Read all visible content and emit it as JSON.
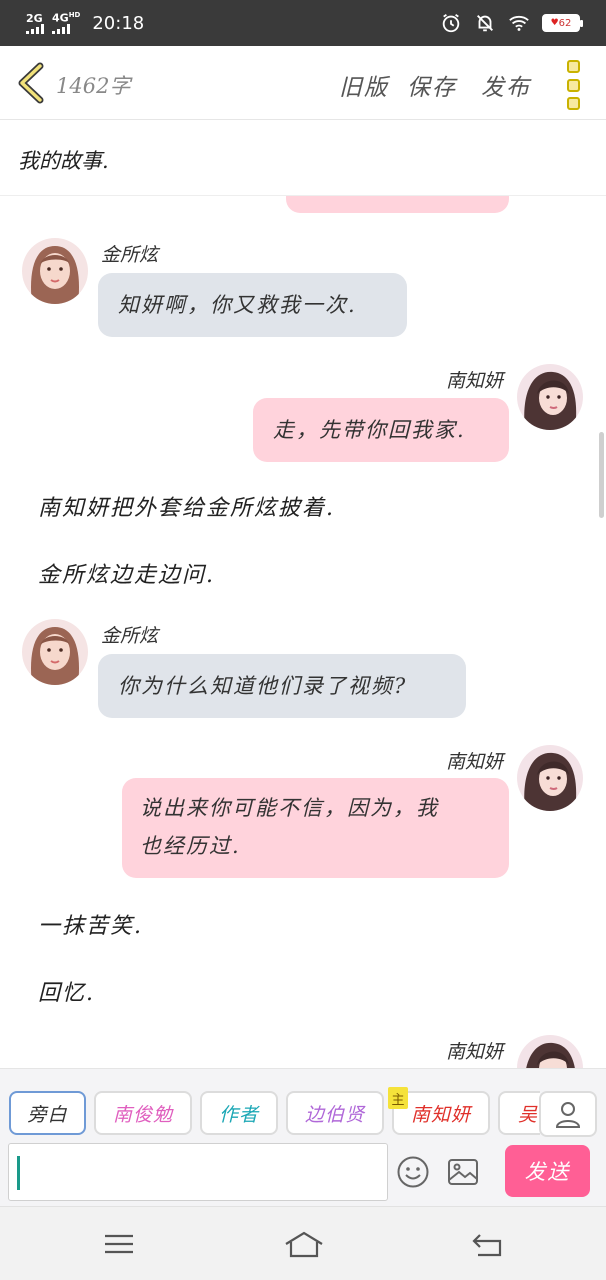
{
  "status_bar": {
    "network_1": "2G",
    "network_2": "4G",
    "network_2_suffix": "HD",
    "time": "20:18",
    "battery_label": "62"
  },
  "header": {
    "word_count": "1462字",
    "old_version": "旧版",
    "save": "保存",
    "publish": "发布"
  },
  "story": {
    "title": "我的故事."
  },
  "chat": {
    "messages": [
      {
        "speaker": "金所炫",
        "text": "知妍啊，你又救我一次."
      },
      {
        "speaker": "南知妍",
        "text": "走，先带你回我家."
      },
      {
        "narration": "南知妍把外套给金所炫披着."
      },
      {
        "narration": "金所炫边走边问."
      },
      {
        "speaker": "金所炫",
        "text": "你为什么知道他们录了视频?"
      },
      {
        "speaker": "南知妍",
        "line1": "说出来你可能不信，因为，我",
        "line2": "也经历过."
      },
      {
        "narration": "一抹苦笑."
      },
      {
        "narration": "回忆."
      },
      {
        "speaker": "南知妍"
      }
    ]
  },
  "roles": {
    "tabs": [
      "旁白",
      "南俊勉",
      "作者",
      "边伯贤",
      "南知妍",
      "吴"
    ],
    "tab_colors": [
      "#333333",
      "#e05fbf",
      "#1ba7b5",
      "#b068d8",
      "#e0302a",
      "#e0302a"
    ],
    "host_badge": "主"
  },
  "composer": {
    "input_value": "",
    "send": "发送"
  },
  "colors": {
    "accent_send": "#ff5f95",
    "bubble_left": "#e0e4ea",
    "bubble_right": "#ffd3dc",
    "back_chevron": "#c9b200"
  }
}
